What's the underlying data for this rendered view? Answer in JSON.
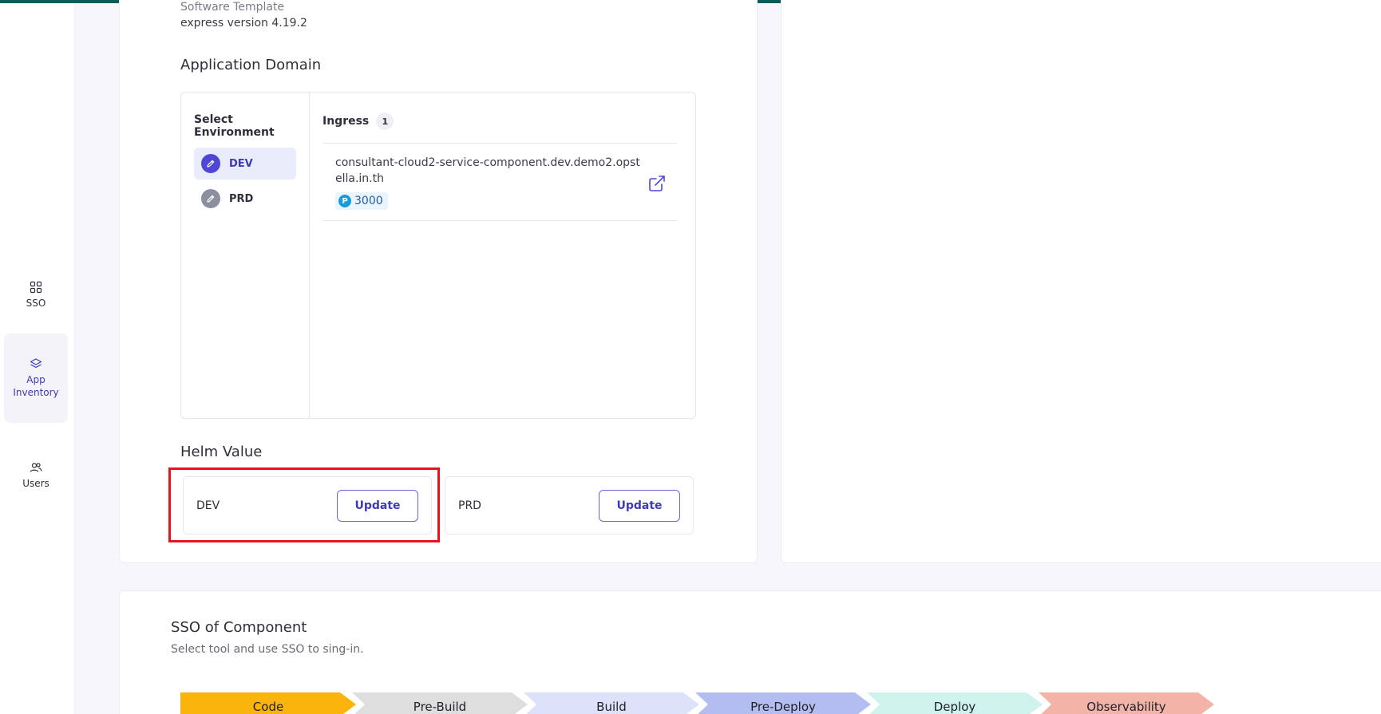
{
  "sidebar": {
    "items": [
      {
        "label": "SSO",
        "icon": "grid-icon"
      },
      {
        "label": "App Inventory",
        "icon": "layers-icon",
        "active": true
      },
      {
        "label": "Users",
        "icon": "users-icon"
      }
    ]
  },
  "component": {
    "software_template": "Software Template",
    "version": "express version 4.19.2"
  },
  "application_domain": {
    "title": "Application Domain",
    "select_environment_label": "Select Environment",
    "environments": [
      {
        "label": "DEV",
        "active": true
      },
      {
        "label": "PRD",
        "active": false
      }
    ],
    "ingress": {
      "label": "Ingress",
      "count": "1",
      "entries": [
        {
          "host": "consultant-cloud2-service-component.dev.demo2.opstella.in.th",
          "port_prefix": "P",
          "port": "3000"
        }
      ]
    }
  },
  "helm_value": {
    "title": "Helm Value",
    "cards": [
      {
        "env": "DEV",
        "button": "Update"
      },
      {
        "env": "PRD",
        "button": "Update"
      }
    ]
  },
  "sso_section": {
    "title": "SSO of Component",
    "subtitle": "Select tool and use SSO to sing-in.",
    "stages": [
      {
        "label": "Code",
        "color": "#fbb40c"
      },
      {
        "label": "Pre-Build",
        "color": "#dedede"
      },
      {
        "label": "Build",
        "color": "#dde2f8"
      },
      {
        "label": "Pre-Deploy",
        "color": "#b3bdf0"
      },
      {
        "label": "Deploy",
        "color": "#cdf3ec"
      },
      {
        "label": "Observability",
        "color": "#f3b4a8"
      }
    ]
  },
  "colors": {
    "accent": "#3f3ab8",
    "topbar": "#0f5b5c",
    "highlight": "#e4131f"
  }
}
